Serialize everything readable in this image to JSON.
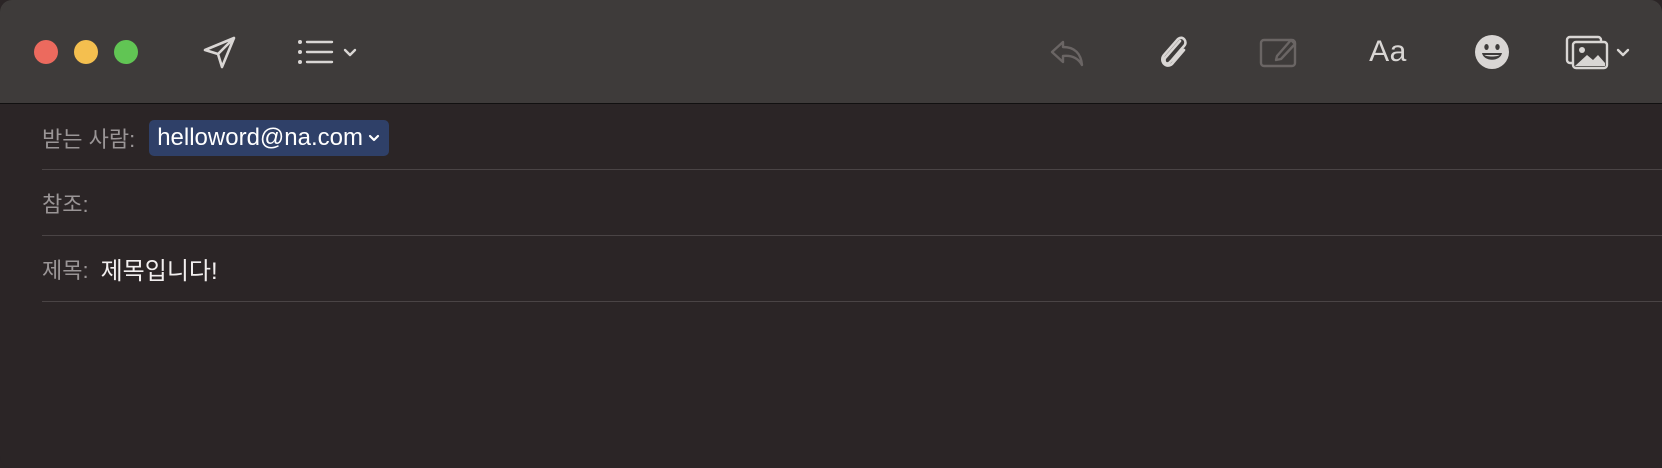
{
  "window": {
    "traffic_lights": [
      "close-button",
      "minimize-button",
      "zoom-button"
    ]
  },
  "toolbar": {
    "send_icon": "paper-plane-icon",
    "header_fields_icon": "list-icon",
    "reply_icon": "reply-arrow-icon",
    "attach_icon": "paperclip-icon",
    "markup_icon": "markup-pencil-icon",
    "format_label": "Aa",
    "emoji_icon": "smiley-face-icon",
    "photo_icon": "photo-browser-icon"
  },
  "fields": {
    "to_label": "받는 사람:",
    "to_recipient": "helloword@na.com",
    "cc_label": "참조:",
    "subject_label": "제목:",
    "subject_value": "제목입니다!"
  },
  "colors": {
    "titlebar": "#3e3b3a",
    "body": "#2b2526",
    "chip": "#2f4068",
    "close": "#ec6a5e",
    "minimize": "#f4bf4f",
    "zoom": "#61c554"
  }
}
